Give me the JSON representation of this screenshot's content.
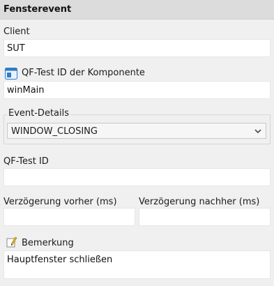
{
  "header": {
    "title": "Fensterevent"
  },
  "client": {
    "label": "Client",
    "value": "SUT"
  },
  "component": {
    "label": "QF-Test ID der Komponente",
    "value": "winMain",
    "icon": "component-icon"
  },
  "event_details": {
    "label": "Event-Details",
    "selected": "WINDOW_CLOSING"
  },
  "qftest_id": {
    "label": "QF-Test ID",
    "value": ""
  },
  "delay_before": {
    "label": "Verzögerung vorher (ms)",
    "value": ""
  },
  "delay_after": {
    "label": "Verzögerung nachher (ms)",
    "value": ""
  },
  "remark": {
    "label": "Bemerkung",
    "value": "Hauptfenster schließen",
    "icon": "pencil-icon"
  }
}
